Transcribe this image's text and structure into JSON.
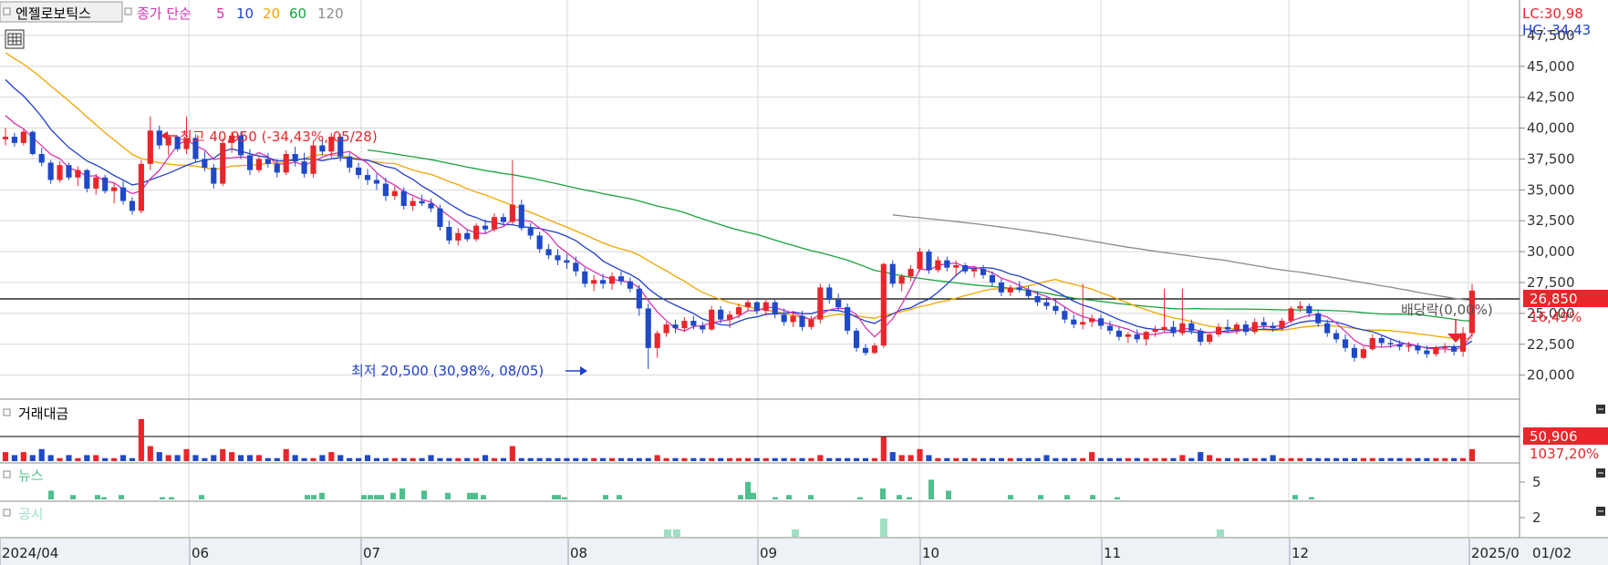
{
  "header": {
    "stock_name": "엔젤로보틱스",
    "ma_label": "종가 단순",
    "ma_periods": [
      "5",
      "10",
      "20",
      "60",
      "120"
    ],
    "ma_colors": [
      "#d633b5",
      "#1f3fcf",
      "#f0a500",
      "#17a33a",
      "#8c8c8c"
    ]
  },
  "corner": {
    "lc": "LC:30,98",
    "hc": "HC:-34,43"
  },
  "annotations": {
    "high": "최고 40,950 (-34,43%, 05/28)",
    "low": "최저 20,500 (30,98%, 08/05)",
    "dividend": "배당락(0,00%)"
  },
  "price_tag": {
    "value": "26,850",
    "change": "16,49%"
  },
  "volume_panel": {
    "title": "거래대금",
    "tag_value": "50,906",
    "tag_change": "1037,20%"
  },
  "news_panel": {
    "title": "뉴스",
    "tick": "5"
  },
  "disclosure_panel": {
    "title": "공시",
    "tick": "2"
  },
  "colors": {
    "up": "#e8262b",
    "down": "#1f49c9",
    "bar_green": "#4fbf8e",
    "bar_lightgreen": "#9fe0c3",
    "grid": "#d8d8d8"
  },
  "chart_data": {
    "type": "candlestick",
    "price_axis": {
      "ticks": [
        "47,500",
        "45,000",
        "42,500",
        "40,000",
        "37,500",
        "35,000",
        "32,500",
        "30,000",
        "27,500",
        "25,000",
        "22,500",
        "20,000"
      ],
      "ylim": [
        18500,
        50000
      ]
    },
    "date_axis": {
      "labels": [
        "2024/04",
        "06",
        "07",
        "08",
        "09",
        "10",
        "11",
        "12",
        "2025/0"
      ],
      "right_label": "01/02"
    },
    "reference_price": 26850,
    "ma_start_values": {
      "ma5": 42000,
      "ma10": 45900,
      "ma20": 48700,
      "ma60": 42500,
      "ma120": 35600
    },
    "ohlc": [
      [
        39100,
        40000,
        38600,
        39300
      ],
      [
        39300,
        39600,
        38500,
        38800
      ],
      [
        38800,
        39900,
        38600,
        39700
      ],
      [
        39700,
        39800,
        37800,
        37900
      ],
      [
        37900,
        38400,
        36900,
        37200
      ],
      [
        37200,
        37400,
        35500,
        35800
      ],
      [
        35800,
        37300,
        35600,
        37000
      ],
      [
        37000,
        37200,
        35800,
        36000
      ],
      [
        36000,
        36900,
        35300,
        36600
      ],
      [
        36600,
        36700,
        34800,
        35100
      ],
      [
        35100,
        36300,
        34600,
        36000
      ],
      [
        36000,
        36200,
        34700,
        34900
      ],
      [
        34900,
        35600,
        33900,
        35200
      ],
      [
        35200,
        35700,
        33800,
        34100
      ],
      [
        34100,
        34400,
        33000,
        33300
      ],
      [
        33300,
        37400,
        33100,
        37100
      ],
      [
        37100,
        40950,
        36600,
        39800
      ],
      [
        39800,
        40200,
        38300,
        38600
      ],
      [
        38600,
        39500,
        37800,
        39300
      ],
      [
        39300,
        39400,
        38100,
        38300
      ],
      [
        38300,
        40950,
        37900,
        39200
      ],
      [
        39200,
        39500,
        37200,
        37500
      ],
      [
        37500,
        38100,
        36500,
        36800
      ],
      [
        36800,
        37100,
        35100,
        35500
      ],
      [
        35500,
        39200,
        35300,
        38800
      ],
      [
        38800,
        39700,
        38000,
        39400
      ],
      [
        39400,
        39700,
        37500,
        37800
      ],
      [
        37800,
        38300,
        36200,
        36600
      ],
      [
        36600,
        37800,
        36400,
        37500
      ],
      [
        37500,
        38000,
        36800,
        37100
      ],
      [
        37100,
        37500,
        36000,
        36400
      ],
      [
        36400,
        38200,
        36200,
        37900
      ],
      [
        37900,
        38500,
        36900,
        37300
      ],
      [
        37300,
        38000,
        36000,
        36300
      ],
      [
        36300,
        39000,
        36000,
        38600
      ],
      [
        38600,
        39200,
        37800,
        38100
      ],
      [
        38100,
        39600,
        37600,
        39300
      ],
      [
        39300,
        39500,
        37300,
        37700
      ],
      [
        37700,
        38000,
        36400,
        36800
      ],
      [
        36800,
        37200,
        35900,
        36200
      ],
      [
        36200,
        36700,
        35400,
        35800
      ],
      [
        35800,
        36300,
        35000,
        35500
      ],
      [
        35500,
        36000,
        34100,
        34500
      ],
      [
        34500,
        35300,
        34200,
        34900
      ],
      [
        34900,
        35200,
        33400,
        33700
      ],
      [
        33700,
        34400,
        33300,
        34100
      ],
      [
        34100,
        34600,
        33700,
        33900
      ],
      [
        33900,
        34300,
        33200,
        33500
      ],
      [
        33500,
        33800,
        31700,
        32000
      ],
      [
        32000,
        32500,
        30600,
        30900
      ],
      [
        30900,
        31900,
        30500,
        31500
      ],
      [
        31500,
        31800,
        30800,
        31000
      ],
      [
        31000,
        32300,
        30800,
        32100
      ],
      [
        32100,
        32600,
        31500,
        31800
      ],
      [
        31800,
        33100,
        31600,
        32800
      ],
      [
        32800,
        33100,
        32100,
        32400
      ],
      [
        32400,
        37400,
        32200,
        33800
      ],
      [
        33800,
        34200,
        31700,
        31900
      ],
      [
        31900,
        32300,
        31000,
        31300
      ],
      [
        31300,
        31600,
        29900,
        30200
      ],
      [
        30200,
        30600,
        29400,
        29700
      ],
      [
        29700,
        30200,
        28900,
        29300
      ],
      [
        29300,
        29800,
        28600,
        29100
      ],
      [
        29100,
        29600,
        28000,
        28400
      ],
      [
        28400,
        28700,
        27100,
        27400
      ],
      [
        27400,
        28100,
        26800,
        27700
      ],
      [
        27700,
        28200,
        27000,
        27400
      ],
      [
        27400,
        28300,
        26900,
        28000
      ],
      [
        28000,
        28400,
        27300,
        27600
      ],
      [
        27600,
        27900,
        26700,
        27000
      ],
      [
        27000,
        27300,
        24800,
        25400
      ],
      [
        25400,
        25800,
        20500,
        22200
      ],
      [
        22200,
        23600,
        21400,
        23400
      ],
      [
        23400,
        24300,
        23100,
        24100
      ],
      [
        24100,
        24500,
        23400,
        23800
      ],
      [
        23800,
        24700,
        23500,
        24400
      ],
      [
        24400,
        24800,
        23700,
        24000
      ],
      [
        24000,
        24300,
        23400,
        23700
      ],
      [
        23700,
        25600,
        23600,
        25300
      ],
      [
        25300,
        25600,
        24200,
        24500
      ],
      [
        24500,
        25200,
        23800,
        24900
      ],
      [
        24900,
        25800,
        24600,
        25500
      ],
      [
        25500,
        26200,
        25200,
        25900
      ],
      [
        25900,
        26000,
        24900,
        25200
      ],
      [
        25200,
        26200,
        24800,
        25900
      ],
      [
        25900,
        26200,
        24600,
        24900
      ],
      [
        24900,
        25400,
        24000,
        24300
      ],
      [
        24300,
        25200,
        23900,
        24800
      ],
      [
        24800,
        25200,
        23600,
        23900
      ],
      [
        23900,
        24800,
        23700,
        24500
      ],
      [
        24500,
        27400,
        24200,
        27100
      ],
      [
        27100,
        27400,
        25800,
        26100
      ],
      [
        26100,
        26600,
        25200,
        25500
      ],
      [
        25500,
        25800,
        23300,
        23600
      ],
      [
        23600,
        23800,
        21900,
        22200
      ],
      [
        22200,
        22500,
        21600,
        21800
      ],
      [
        21800,
        22600,
        21700,
        22400
      ],
      [
        22400,
        29100,
        22200,
        29000
      ],
      [
        29000,
        29300,
        27100,
        27400
      ],
      [
        27400,
        28200,
        26800,
        28000
      ],
      [
        28000,
        28900,
        27600,
        28600
      ],
      [
        28600,
        30300,
        28400,
        30000
      ],
      [
        30000,
        30200,
        28200,
        28500
      ],
      [
        28500,
        29600,
        28300,
        29300
      ],
      [
        29300,
        29600,
        28400,
        28700
      ],
      [
        28700,
        29300,
        28000,
        28900
      ],
      [
        28900,
        29100,
        28200,
        28400
      ],
      [
        28400,
        28800,
        27900,
        28600
      ],
      [
        28600,
        28900,
        27800,
        28100
      ],
      [
        28100,
        28400,
        27200,
        27500
      ],
      [
        27500,
        27800,
        26400,
        26700
      ],
      [
        26700,
        27300,
        26400,
        27100
      ],
      [
        27100,
        27600,
        26700,
        26900
      ],
      [
        26900,
        27200,
        26100,
        26400
      ],
      [
        26400,
        26800,
        25600,
        25900
      ],
      [
        25900,
        26300,
        25300,
        25600
      ],
      [
        25600,
        26100,
        24900,
        25200
      ],
      [
        25200,
        25500,
        24200,
        24500
      ],
      [
        24500,
        24900,
        23800,
        24100
      ],
      [
        24100,
        27400,
        23700,
        24300
      ],
      [
        24300,
        24900,
        23900,
        24600
      ],
      [
        24600,
        24900,
        23700,
        24000
      ],
      [
        24000,
        24400,
        23300,
        23600
      ],
      [
        23600,
        23900,
        22800,
        23100
      ],
      [
        23100,
        23500,
        22600,
        23300
      ],
      [
        23300,
        23700,
        22600,
        22900
      ],
      [
        22900,
        23600,
        22400,
        23500
      ],
      [
        23500,
        24000,
        23100,
        23700
      ],
      [
        23700,
        27000,
        23500,
        23900
      ],
      [
        23900,
        24400,
        23100,
        23400
      ],
      [
        23400,
        27000,
        23200,
        24200
      ],
      [
        24200,
        24500,
        23300,
        23600
      ],
      [
        23600,
        23800,
        22400,
        22700
      ],
      [
        22700,
        23500,
        22500,
        23300
      ],
      [
        23300,
        24200,
        23100,
        23900
      ],
      [
        23900,
        24500,
        23400,
        23700
      ],
      [
        23700,
        24300,
        23300,
        24100
      ],
      [
        24100,
        24400,
        23200,
        23500
      ],
      [
        23500,
        24600,
        23300,
        24300
      ],
      [
        24300,
        24700,
        23700,
        24000
      ],
      [
        24000,
        24300,
        23500,
        23800
      ],
      [
        23800,
        24600,
        23600,
        24400
      ],
      [
        24400,
        25600,
        24200,
        25400
      ],
      [
        25400,
        26000,
        25100,
        25600
      ],
      [
        25600,
        25800,
        24700,
        25000
      ],
      [
        25000,
        25300,
        23900,
        24200
      ],
      [
        24200,
        24500,
        23100,
        23400
      ],
      [
        23400,
        23700,
        22600,
        22900
      ],
      [
        22900,
        23300,
        21900,
        22200
      ],
      [
        22200,
        22500,
        21100,
        21400
      ],
      [
        21400,
        22300,
        21300,
        22100
      ],
      [
        22100,
        23300,
        22000,
        23000
      ],
      [
        23000,
        23200,
        22300,
        22600
      ],
      [
        22600,
        22900,
        22200,
        22500
      ],
      [
        22500,
        22800,
        22000,
        22300
      ],
      [
        22300,
        22700,
        21900,
        22400
      ],
      [
        22400,
        22600,
        21700,
        22000
      ],
      [
        22000,
        22400,
        21400,
        21700
      ],
      [
        21700,
        22400,
        21500,
        22200
      ],
      [
        22200,
        22600,
        21800,
        22300
      ],
      [
        22300,
        22500,
        21600,
        21900
      ],
      [
        21900,
        23900,
        21500,
        23400
      ],
      [
        23400,
        27400,
        23100,
        26850
      ]
    ],
    "volume_bars": [
      3,
      2,
      3,
      2,
      4,
      2,
      1,
      2,
      1,
      2,
      2,
      1,
      1,
      2,
      1,
      14,
      5,
      3,
      2,
      2,
      4,
      2,
      1,
      2,
      4,
      3,
      2,
      2,
      2,
      1,
      1,
      4,
      2,
      1,
      1,
      2,
      3,
      2,
      1,
      1,
      2,
      1,
      1,
      1,
      1,
      1,
      1,
      2,
      1,
      1,
      1,
      1,
      1,
      2,
      1,
      1,
      5,
      1,
      1,
      1,
      1,
      1,
      1,
      1,
      1,
      1,
      1,
      1,
      1,
      1,
      1,
      1,
      2,
      1,
      1,
      1,
      1,
      1,
      1,
      1,
      1,
      1,
      1,
      1,
      1,
      1,
      1,
      1,
      1,
      1,
      2,
      1,
      1,
      1,
      1,
      1,
      1,
      8,
      3,
      2,
      2,
      4,
      2,
      1,
      1,
      1,
      1,
      1,
      1,
      1,
      1,
      1,
      1,
      1,
      1,
      2,
      1,
      1,
      1,
      1,
      3,
      1,
      1,
      1,
      1,
      1,
      1,
      1,
      1,
      1,
      2,
      1,
      3,
      2,
      1,
      1,
      1,
      1,
      1,
      1,
      2,
      1,
      1,
      1,
      1,
      1,
      1,
      1,
      1,
      1,
      1,
      1,
      1,
      1,
      1,
      1,
      1,
      1,
      1,
      1,
      1,
      1,
      4
    ],
    "news_bars": [
      [
        56,
        4
      ],
      [
        80,
        2
      ],
      [
        107,
        2
      ],
      [
        114,
        1
      ],
      [
        133,
        2
      ],
      [
        178,
        1
      ],
      [
        188,
        1
      ],
      [
        221,
        2
      ],
      [
        337,
        2
      ],
      [
        344,
        2
      ],
      [
        353,
        3
      ],
      [
        399,
        2
      ],
      [
        406,
        2
      ],
      [
        413,
        2
      ],
      [
        418,
        2
      ],
      [
        431,
        3
      ],
      [
        441,
        5
      ],
      [
        465,
        4
      ],
      [
        491,
        3
      ],
      [
        515,
        3
      ],
      [
        521,
        3
      ],
      [
        530,
        2
      ],
      [
        608,
        2
      ],
      [
        612,
        2
      ],
      [
        619,
        1
      ],
      [
        664,
        2
      ],
      [
        679,
        2
      ],
      [
        812,
        2
      ],
      [
        820,
        8
      ],
      [
        826,
        3
      ],
      [
        850,
        1
      ],
      [
        865,
        2
      ],
      [
        889,
        2
      ],
      [
        943,
        1
      ],
      [
        968,
        5
      ],
      [
        986,
        2
      ],
      [
        997,
        1
      ],
      [
        1021,
        9
      ],
      [
        1040,
        4
      ],
      [
        1108,
        2
      ],
      [
        1141,
        2
      ],
      [
        1170,
        2
      ],
      [
        1198,
        2
      ],
      [
        1225,
        1
      ],
      [
        1420,
        2
      ],
      [
        1438,
        1
      ]
    ],
    "disclosure_bars": [
      [
        732,
        4
      ],
      [
        742,
        4
      ],
      [
        872,
        4
      ],
      [
        969,
        10
      ],
      [
        1338,
        4
      ]
    ]
  }
}
